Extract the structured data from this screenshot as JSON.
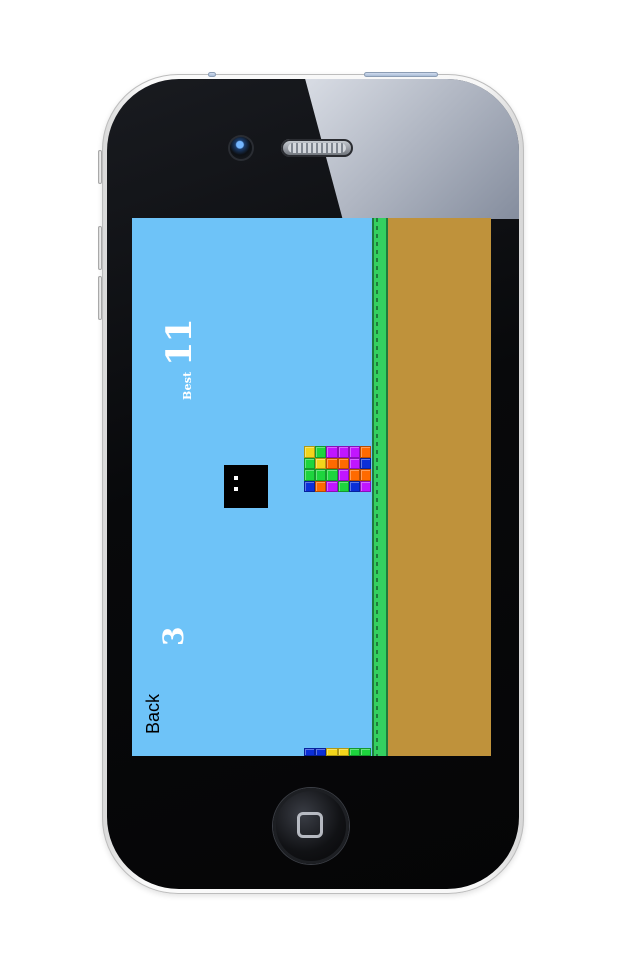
{
  "device": {
    "icons": {
      "camera": "camera-icon",
      "speaker": "speaker-icon",
      "home": "home-button-icon"
    }
  },
  "game": {
    "best_label": "Best",
    "best_score": "11",
    "current_score": "3",
    "back_label": "Back",
    "colors": {
      "sky": "#6ec3f8",
      "grass": "#34d060",
      "grass_dark": "#1f7b3d",
      "dirt": "#bf923b",
      "player": "#000000",
      "text": "#ffffff"
    },
    "block_palette": [
      "#0b2fd8",
      "#1dd53d",
      "#f3d51b",
      "#ff6a00",
      "#c116ff",
      "#ff4b8a"
    ],
    "main_blocks": [
      [
        "#f3d51b",
        "#1dd53d",
        "#c116ff",
        "#c116ff",
        "#c116ff",
        "#ff6a00"
      ],
      [
        "#1dd53d",
        "#f3d51b",
        "#ff6a00",
        "#ff6a00",
        "#c116ff",
        "#0b2fd8"
      ],
      [
        "#1dd53d",
        "#1dd53d",
        "#1dd53d",
        "#c116ff",
        "#ff6a00",
        "#ff6a00"
      ],
      [
        "#0b2fd8",
        "#ff6a00",
        "#c116ff",
        "#1dd53d",
        "#0b2fd8",
        "#c116ff"
      ]
    ],
    "bottom_blocks": [
      [
        "#0b2fd8",
        "#0b2fd8",
        "#f3d51b",
        "#f3d51b",
        "#1dd53d",
        "#1dd53d"
      ]
    ]
  }
}
